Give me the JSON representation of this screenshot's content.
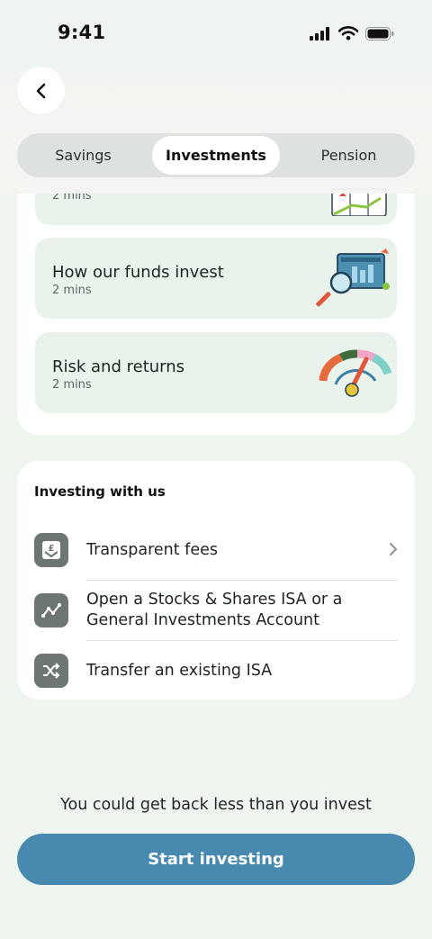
{
  "status_bar": {
    "time": "9:41"
  },
  "tabs": [
    {
      "label": "Savings",
      "active": false
    },
    {
      "label": "Investments",
      "active": true
    },
    {
      "label": "Pension",
      "active": false
    }
  ],
  "lessons": [
    {
      "title": "",
      "duration": "2 mins",
      "icon": "chart-board-illustration"
    },
    {
      "title": "How our funds invest",
      "duration": "2 mins",
      "icon": "magnifier-chart-illustration"
    },
    {
      "title": "Risk and returns",
      "duration": "2 mins",
      "icon": "risk-gauge-illustration"
    }
  ],
  "investing": {
    "heading": "Investing with us",
    "items": [
      {
        "label": "Transparent fees",
        "icon": "pound-box-icon",
        "has_chevron": true
      },
      {
        "label": "Open a Stocks & Shares ISA or a General Investments Account",
        "line1": "Open a Stocks & Shares ISA or a",
        "line2": "General Investments Account",
        "icon": "line-chart-icon",
        "has_chevron": false
      },
      {
        "label": "Transfer an existing ISA",
        "icon": "shuffle-icon",
        "has_chevron": false
      }
    ]
  },
  "disclaimer": "You could get back less than you invest",
  "cta": {
    "label": "Start investing"
  },
  "colors": {
    "background": "#eef5ef",
    "cta": "#4789af",
    "lesson_card": "#e9f3ec",
    "icon_tile": "#6e7671"
  }
}
